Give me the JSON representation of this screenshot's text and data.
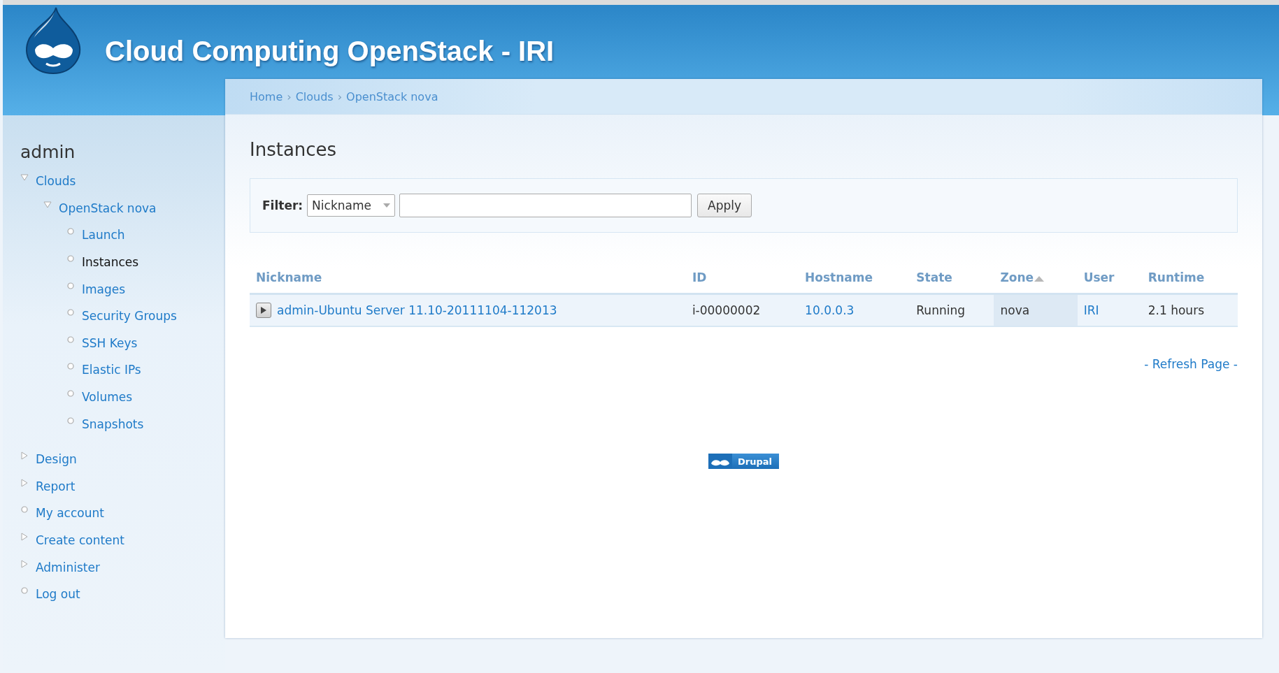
{
  "site_title": "Cloud Computing OpenStack - IRI",
  "breadcrumb": [
    "Home",
    "Clouds",
    "OpenStack nova"
  ],
  "breadcrumb_separator": "›",
  "sidebar": {
    "title": "admin",
    "items": [
      {
        "label": "Clouds",
        "kind": "branch",
        "expanded": true,
        "active": false,
        "children": [
          {
            "label": "OpenStack nova",
            "kind": "branch",
            "expanded": true,
            "active": false,
            "children": [
              {
                "label": "Launch",
                "kind": "leaf",
                "active": false
              },
              {
                "label": "Instances",
                "kind": "leaf",
                "active": true
              },
              {
                "label": "Images",
                "kind": "leaf",
                "active": false
              },
              {
                "label": "Security Groups",
                "kind": "leaf",
                "active": false
              },
              {
                "label": "SSH Keys",
                "kind": "leaf",
                "active": false
              },
              {
                "label": "Elastic IPs",
                "kind": "leaf",
                "active": false
              },
              {
                "label": "Volumes",
                "kind": "leaf",
                "active": false
              },
              {
                "label": "Snapshots",
                "kind": "leaf",
                "active": false
              }
            ]
          }
        ]
      },
      {
        "label": "Design",
        "kind": "branch",
        "expanded": false,
        "active": false
      },
      {
        "label": "Report",
        "kind": "branch",
        "expanded": false,
        "active": false
      },
      {
        "label": "My account",
        "kind": "leaf",
        "active": false
      },
      {
        "label": "Create content",
        "kind": "branch",
        "expanded": false,
        "active": false
      },
      {
        "label": "Administer",
        "kind": "branch",
        "expanded": false,
        "active": false
      },
      {
        "label": "Log out",
        "kind": "leaf",
        "active": false
      }
    ]
  },
  "page_title": "Instances",
  "filter": {
    "label": "Filter:",
    "select": "Nickname",
    "button": "Apply"
  },
  "table": {
    "columns": [
      {
        "label": "Nickname",
        "sorted": false
      },
      {
        "label": "ID",
        "sorted": false
      },
      {
        "label": "Hostname",
        "sorted": false
      },
      {
        "label": "State",
        "sorted": false
      },
      {
        "label": "Zone",
        "sorted": true
      },
      {
        "label": "User",
        "sorted": false
      },
      {
        "label": "Runtime",
        "sorted": false
      }
    ],
    "rows": [
      {
        "cells": [
          {
            "text": "admin-Ubuntu Server 11.10-20111104-112013",
            "kind": "link"
          },
          {
            "text": "i-00000002",
            "kind": "text"
          },
          {
            "text": "10.0.0.3",
            "kind": "link"
          },
          {
            "text": "Running",
            "kind": "text"
          },
          {
            "text": "nova",
            "kind": "text"
          },
          {
            "text": "IRI",
            "kind": "link"
          },
          {
            "text": "2.1 hours",
            "kind": "text"
          }
        ]
      }
    ]
  },
  "refresh_link": "- Refresh Page -",
  "footer_badge": "Drupal"
}
